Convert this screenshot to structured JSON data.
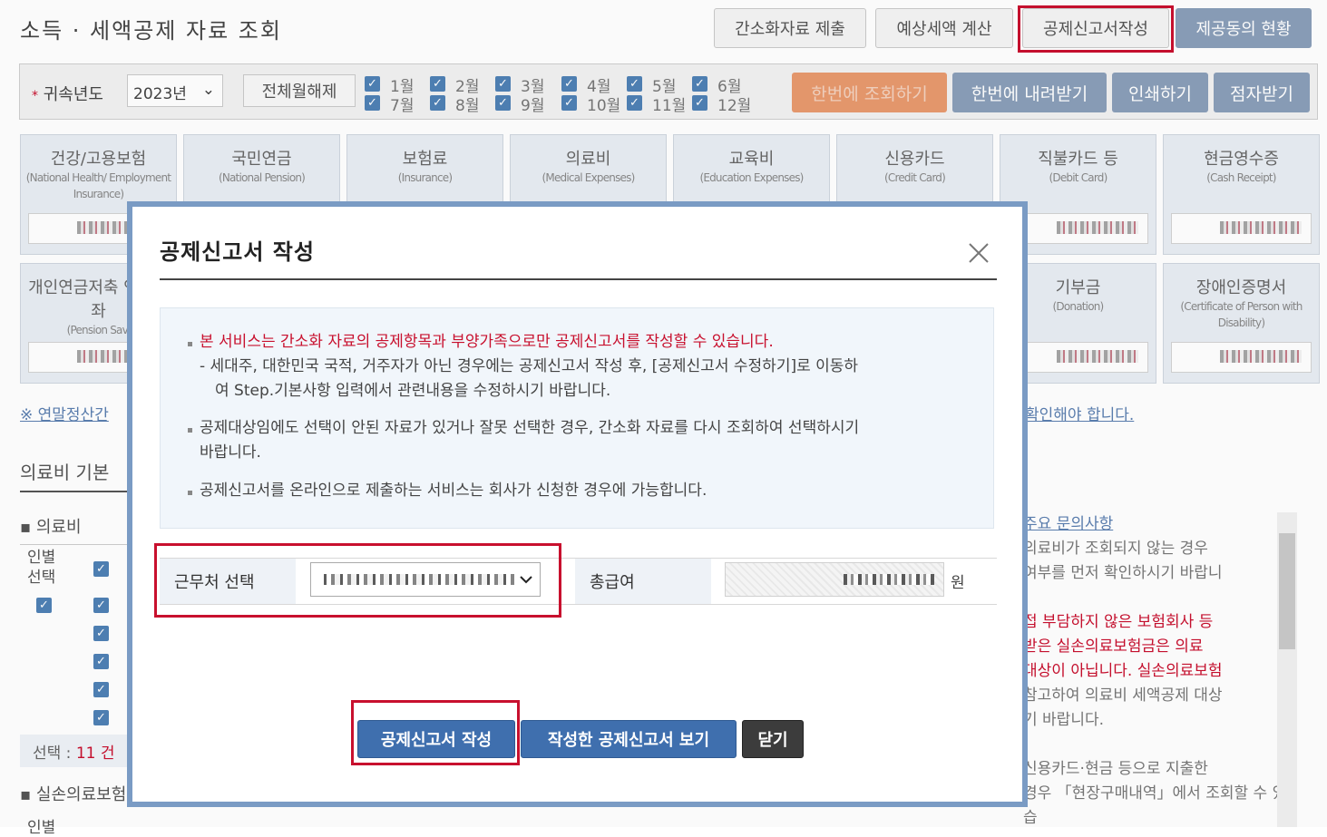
{
  "page": {
    "title": "소득 · 세액공제 자료 조회",
    "top_buttons": [
      "간소화자료 제출",
      "예상세액 계산",
      "공제신고서작성",
      "제공동의 현황"
    ]
  },
  "filter": {
    "year_label": "귀속년도",
    "year_value": "2023년",
    "all_months_button": "전체월해제",
    "months": [
      "1월",
      "2월",
      "3월",
      "4월",
      "5월",
      "6월",
      "7월",
      "8월",
      "9월",
      "10월",
      "11월",
      "12월"
    ],
    "actions": [
      "한번에 조회하기",
      "한번에 내려받기",
      "인쇄하기",
      "점자받기"
    ]
  },
  "cards_row1": [
    {
      "kr": "건강/고용보험",
      "en": "(National Health/ Employment Insurance)"
    },
    {
      "kr": "국민연금",
      "en": "(National Pension)"
    },
    {
      "kr": "보험료",
      "en": "(Insurance)"
    },
    {
      "kr": "의료비",
      "en": "(Medical Expenses)"
    },
    {
      "kr": "교육비",
      "en": "(Education Expenses)"
    },
    {
      "kr": "신용카드",
      "en": "(Credit Card)"
    },
    {
      "kr": "직불카드 등",
      "en": "(Debit Card)"
    },
    {
      "kr": "현금영수증",
      "en": "(Cash Receipt)"
    }
  ],
  "cards_row2": [
    {
      "kr": "개인연금저축 연금계좌",
      "en": "(Pension Savi"
    },
    {
      "kr": "기부금",
      "en": "(Donation)"
    },
    {
      "kr": "장애인증명서",
      "en": "(Certificate of Person with Disability)"
    }
  ],
  "background": {
    "note_left": "※ 연말정산간",
    "note_right": "확인해야 합니다.",
    "section_title": "의료비 기본",
    "sub_title": "의료비",
    "col_individual": "인별 선택",
    "selection_prefix": "선택 : ",
    "selection_count": "11 건",
    "sub_title2": "실손의료보험",
    "col_individual2": "인별",
    "right_link": "주요 문의사항",
    "right_text": [
      "의료비가 조회되지 않는 경우",
      "여부를 먼저 확인하시기 바랍니",
      "",
      "접 부담하지 않은 보험회사 등",
      "받은 실손의료보험금은 의료",
      "대상이 아닙니다. 실손의료보험",
      "참고하여 의료비 세액공제 대상",
      "기 바랍니다.",
      "",
      "신용카드·현금 등으로 지출한",
      "경우 「현장구매내역」에서 조회할 수 있습"
    ]
  },
  "modal": {
    "title": "공제신고서 작성",
    "info": {
      "line1": "본 서비스는 간소화 자료의 공제항목과 부양가족으로만 공제신고서를 작성할 수 있습니다.",
      "line2": "- 세대주, 대한민국 국적, 거주자가 아닌 경우에는 공제신고서 작성 후, [공제신고서 수정하기]로 이동하",
      "line3": "여 Step.기본사항 입력에서 관련내용을 수정하시기 바랍니다.",
      "line4": "공제대상임에도 선택이 안된 자료가 있거나 잘못 선택한 경우, 간소화 자료를 다시 조회하여 선택하시기",
      "line5": "바랍니다.",
      "line6": "공제신고서를 온라인으로 제출하는 서비스는 회사가 신청한 경우에 가능합니다."
    },
    "workplace_label": "근무처 선택",
    "total_pay_label": "총급여",
    "currency_unit": "원",
    "buttons": {
      "write": "공제신고서 작성",
      "view": "작성한 공제신고서 보기",
      "close": "닫기"
    }
  },
  "colors": {
    "accent_blue": "#3f6fae",
    "highlight_red": "#c8102e",
    "modal_border": "#7a9bc4"
  }
}
